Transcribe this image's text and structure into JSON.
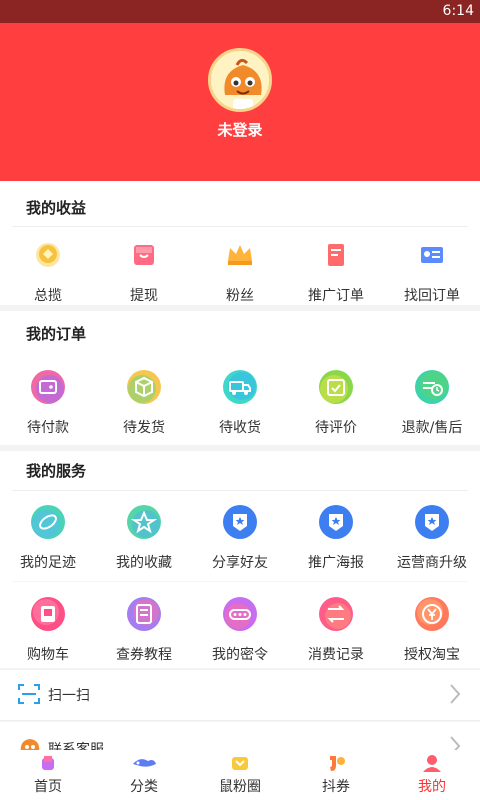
{
  "status_bar": {
    "time": "6:14"
  },
  "header": {
    "login_label": "未登录"
  },
  "earnings": {
    "title": "我的收益",
    "items": [
      {
        "label": "总揽",
        "icon": "gold-coin-icon"
      },
      {
        "label": "提现",
        "icon": "gift-bag-icon"
      },
      {
        "label": "粉丝",
        "icon": "crown-icon"
      },
      {
        "label": "推广订单",
        "icon": "order-doc-icon"
      },
      {
        "label": "找回订单",
        "icon": "id-card-icon"
      }
    ]
  },
  "orders": {
    "title": "我的订单",
    "items": [
      {
        "label": "待付款",
        "icon": "wallet-icon"
      },
      {
        "label": "待发货",
        "icon": "package-icon"
      },
      {
        "label": "待收货",
        "icon": "truck-icon"
      },
      {
        "label": "待评价",
        "icon": "calendar-check-icon"
      },
      {
        "label": "退款/售后",
        "icon": "refund-icon"
      }
    ]
  },
  "services": {
    "title": "我的服务",
    "items": [
      {
        "label": "我的足迹",
        "icon": "footprint-icon"
      },
      {
        "label": "我的收藏",
        "icon": "star-icon"
      },
      {
        "label": "分享好友",
        "icon": "share-badge-icon"
      },
      {
        "label": "推广海报",
        "icon": "poster-badge-icon"
      },
      {
        "label": "运营商升级",
        "icon": "upgrade-badge-icon"
      },
      {
        "label": "购物车",
        "icon": "cart-icon"
      },
      {
        "label": "查券教程",
        "icon": "tutorial-icon"
      },
      {
        "label": "我的密令",
        "icon": "password-icon"
      },
      {
        "label": "消费记录",
        "icon": "record-icon"
      },
      {
        "label": "授权淘宝",
        "icon": "yuan-icon"
      }
    ]
  },
  "list": {
    "scan": "扫一扫",
    "support": "联系客服"
  },
  "tabs": [
    {
      "label": "首页",
      "icon": "home-icon"
    },
    {
      "label": "分类",
      "icon": "category-icon"
    },
    {
      "label": "鼠粉圈",
      "icon": "circle-icon"
    },
    {
      "label": "抖券",
      "icon": "coupon-icon"
    },
    {
      "label": "我的",
      "icon": "profile-icon",
      "active": true
    }
  ],
  "colors": {
    "brand_red": "#ff3f3f",
    "status_bar": "#8a2524",
    "active_tab": "#f33"
  }
}
